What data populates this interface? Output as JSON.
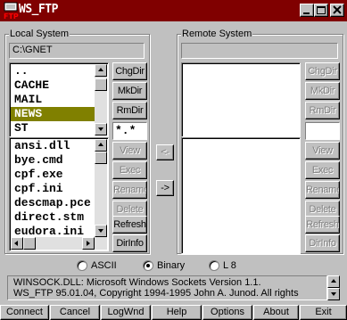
{
  "window": {
    "title": "WS_FTP",
    "icon_label": "FTP"
  },
  "local": {
    "label": "Local System",
    "path": "C:\\GNET",
    "directories": [
      "..",
      "CACHE",
      "MAIL",
      "NEWS",
      "ST"
    ],
    "selected_directory": "NEWS",
    "files": [
      "ansi.dll",
      "bye.cmd",
      "cpf.exe",
      "cpf.ini",
      "descmap.pce",
      "direct.stm",
      "eudora.ini"
    ],
    "dir_buttons": {
      "chgdir": "ChgDir",
      "mkdir": "MkDir",
      "rmdir": "RmDir"
    },
    "file_mask": "*.*",
    "file_buttons": {
      "view": "View",
      "exec": "Exec",
      "rename": "Rename",
      "delete": "Delete",
      "refresh": "Refresh",
      "dirinfo": "DirInfo"
    }
  },
  "remote": {
    "label": "Remote System",
    "path": "",
    "dir_buttons": {
      "chgdir": "ChgDir",
      "mkdir": "MkDir",
      "rmdir": "RmDir"
    },
    "file_mask": "",
    "file_buttons": {
      "view": "View",
      "exec": "Exec",
      "rename": "Rename",
      "delete": "Delete",
      "refresh": "Refresh",
      "dirinfo": "DirInfo"
    }
  },
  "transfer": {
    "to_local": "<-",
    "to_remote": "->"
  },
  "transfer_mode": {
    "options": [
      "ASCII",
      "Binary",
      "L 8"
    ],
    "selected": "Binary"
  },
  "log": {
    "line1": "WINSOCK.DLL: Microsoft Windows Sockets Version 1.1.",
    "line2": "WS_FTP 95.01.04, Copyright      1994-1995 John A. Junod. All rights"
  },
  "bottom_buttons": [
    "Connect",
    "Cancel",
    "LogWnd",
    "Help",
    "Options",
    "About",
    "Exit"
  ],
  "icons": {
    "app": "ftp-app-icon",
    "minimize": "minimize-icon",
    "maximize": "maximize-icon",
    "close": "close-icon"
  },
  "colors": {
    "title_bar": "#800000",
    "selection": "#808000",
    "face": "#c0c0c0"
  }
}
